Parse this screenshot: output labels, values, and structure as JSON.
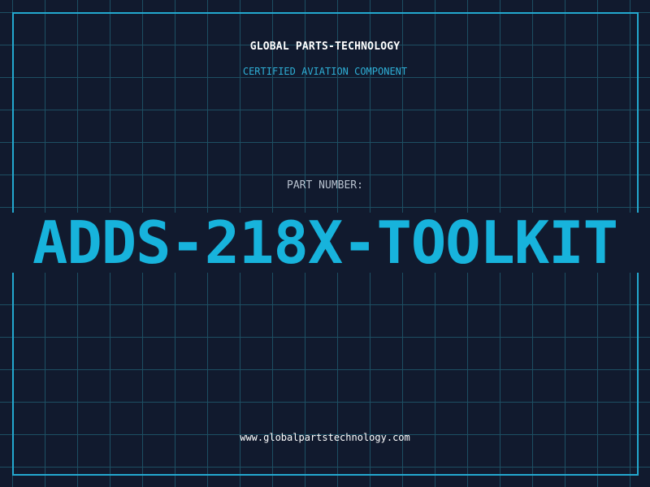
{
  "header": {
    "company_name": "GLOBAL PARTS-TECHNOLOGY",
    "subtitle": "CERTIFIED AVIATION COMPONENT"
  },
  "part": {
    "label": "PART NUMBER:",
    "number": "ADDS-218X-TOOLKIT"
  },
  "footer": {
    "website": "www.globalpartstechnology.com"
  },
  "colors": {
    "background": "#111a2e",
    "grid": "#1d4f63",
    "accent": "#17b3dc",
    "frame": "#23a8cf"
  }
}
